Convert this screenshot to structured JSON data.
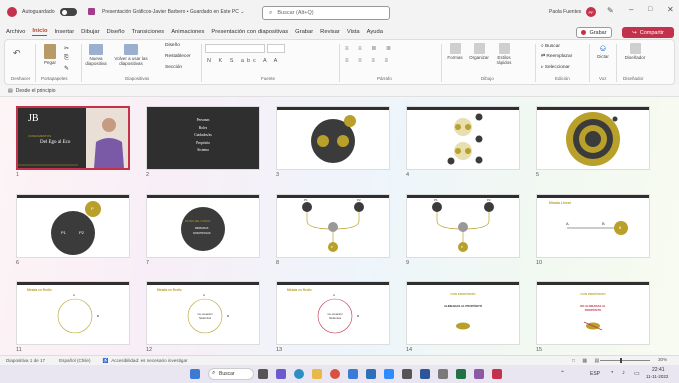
{
  "titlebar": {
    "autosave_label": "Autoguardado",
    "doc_title": "Presentación Gráficos-Javier Barbero • Guardado en Este PC ⌄",
    "search_placeholder": "Buscar (Alt+Q)",
    "user_name": "Paola Fuentes",
    "user_initials": "PF"
  },
  "menu": {
    "items": [
      "Archivo",
      "Inicio",
      "Insertar",
      "Dibujar",
      "Diseño",
      "Transiciones",
      "Animaciones",
      "Presentación con diapositivas",
      "Grabar",
      "Revisar",
      "Vista",
      "Ayuda"
    ],
    "active": "Inicio",
    "grabar_label": "Grabar",
    "compartir_label": "Compartir"
  },
  "ribbon": {
    "groups": [
      "Deshacer",
      "Portapapeles",
      "Diapositivas",
      "Fuente",
      "Párrafo",
      "Dibujo",
      "Edición",
      "Voz",
      "Diseñador"
    ],
    "buttons": {
      "pegar": "Pegar",
      "nueva": "Nueva diapositiva",
      "volver": "Volver a usar las diapositivas",
      "diseno": "Diseño",
      "restablecer": "Restablecer",
      "seccion": "Sección",
      "formas": "Formas",
      "organizar": "Organizar",
      "estilos": "Estilos rápidos",
      "buscar": "Buscar",
      "reemplazar": "Reemplazar",
      "seleccionar": "Seleccionar",
      "dictar": "Dictar",
      "disenador": "Diseñador"
    }
  },
  "qat": {
    "desde_principio": "Desde el principio"
  },
  "slides": [
    {
      "n": "1",
      "selected": true,
      "title": "Del Ego al Eco",
      "logo": "JB",
      "sub": "FUNDAMENTOS"
    },
    {
      "n": "2",
      "items": [
        "Personas",
        "Roles",
        "Cuidados/as",
        "Propósito",
        "Sistema"
      ]
    },
    {
      "n": "3"
    },
    {
      "n": "4"
    },
    {
      "n": "5"
    },
    {
      "n": "6",
      "labels": [
        "P1",
        "P2",
        "P"
      ]
    },
    {
      "n": "7",
      "lines": [
        "FILTRO DEL OTRO/A",
        "PERSONAS",
        "NOSOTROS/AS"
      ]
    },
    {
      "n": "8",
      "labels": [
        "P1",
        "P2",
        "P"
      ]
    },
    {
      "n": "9",
      "labels": [
        "P1",
        "P2",
        "P"
      ]
    },
    {
      "n": "10",
      "heading": "Mirada Lineal",
      "labels": [
        "A",
        "B",
        "B"
      ]
    },
    {
      "n": "11",
      "heading": "Mirada en Red/o",
      "labels": [
        "A",
        "B"
      ]
    },
    {
      "n": "12",
      "heading": "Mirada en Red/o",
      "labels": [
        "A",
        "B",
        "Co-creación Sistémica"
      ]
    },
    {
      "n": "13",
      "heading": "Mirada en Red/o",
      "labels": [
        "A",
        "B",
        "Co-creación Sistémica"
      ]
    },
    {
      "n": "14",
      "lines": [
        "CON PROPÓSITO",
        "ALINEADAS AL PROPÓSITO"
      ]
    },
    {
      "n": "15",
      "lines": [
        "CON PROPÓSITO",
        "NO ALINEADAS AL PROPÓSITO"
      ]
    }
  ],
  "status": {
    "slide_info": "Diapositiva 1 de 17",
    "language": "Español (Chile)",
    "accessibility": "Accesibilidad: es necesario investigar",
    "zoom": "30%"
  },
  "taskbar": {
    "search_label": "Buscar",
    "lang": "ESP",
    "time": "22:41",
    "date": "11-11-2022"
  },
  "colors": {
    "accent": "#c4314b",
    "gold": "#b8a02a",
    "dark": "#3b3b3b"
  }
}
